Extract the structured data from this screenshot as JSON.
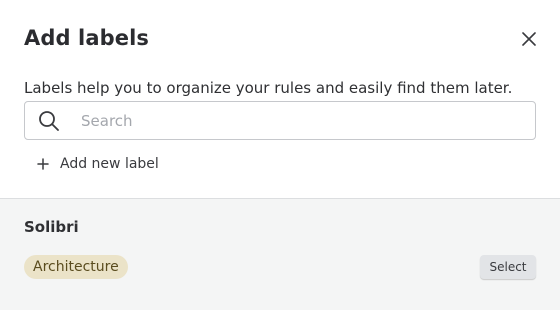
{
  "dialog": {
    "title": "Add labels",
    "close_icon": "close-icon",
    "description": "Labels help you to organize your rules and easily find them later."
  },
  "search": {
    "placeholder": "Search",
    "value": "",
    "icon": "search-icon"
  },
  "add_new_label": {
    "icon": "plus-icon",
    "label": "Add new label"
  },
  "groups": [
    {
      "title": "Solibri",
      "labels": [
        {
          "name": "Architecture",
          "action_label": "Select"
        }
      ]
    }
  ],
  "colors": {
    "chip_background": "#ebe3c8",
    "chip_text": "#5a4c1e",
    "lower_panel_background": "#f4f5f5",
    "select_button_background": "#e2e4e7"
  }
}
